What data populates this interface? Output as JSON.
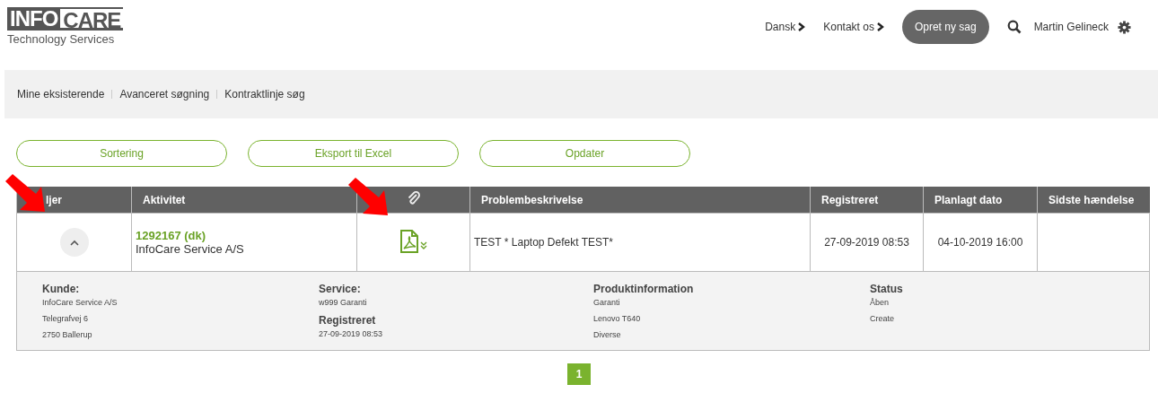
{
  "header": {
    "logo": {
      "left": "INFO",
      "right": "CARE",
      "tagline": "Technology Services"
    },
    "links": [
      {
        "label": "Dansk"
      },
      {
        "label": "Kontakt os"
      }
    ],
    "create_button": "Opret ny sag",
    "user_name": "Martin Gelineck"
  },
  "subnav": [
    "Mine eksisterende",
    "Avanceret søgning",
    "Kontraktlinje søg"
  ],
  "actions": [
    "Sortering",
    "Eksport til Excel",
    "Opdater"
  ],
  "table": {
    "columns": [
      {
        "label": "ljer",
        "kind": "text"
      },
      {
        "label": "Aktivitet",
        "kind": "text"
      },
      {
        "kind": "attachment"
      },
      {
        "label": "Problembeskrivelse",
        "kind": "text"
      },
      {
        "label": "Registreret",
        "kind": "text"
      },
      {
        "label": "Planlagt dato",
        "kind": "text"
      },
      {
        "label": "Sidste hændelse",
        "kind": "text"
      }
    ],
    "rows": [
      {
        "expanded": true,
        "activity_id": "1292167 (dk)",
        "customer": "InfoCare Service A/S",
        "problem": "TEST * Laptop Defekt TEST*",
        "registered": "27-09-2019 08:53",
        "planned": "04-10-2019 16:00",
        "details": [
          {
            "sections": [
              {
                "title": "Kunde:",
                "lines": [
                  "InfoCare Service A/S",
                  "Telegrafvej 6",
                  "2750 Ballerup"
                ]
              }
            ]
          },
          {
            "sections": [
              {
                "title": "Service:",
                "lines": [
                  "w999 Garanti"
                ]
              },
              {
                "title": "Registreret",
                "lines": [
                  "27-09-2019 08:53"
                ]
              }
            ]
          },
          {
            "sections": [
              {
                "title": "Produktinformation",
                "lines": [
                  "Garanti",
                  "Lenovo T640",
                  "Diverse"
                ]
              }
            ]
          },
          {
            "sections": [
              {
                "title": "Status",
                "lines": [
                  "Åben",
                  "Create"
                ]
              }
            ]
          }
        ]
      }
    ]
  },
  "pagination": [
    {
      "label": "1",
      "selected": true
    }
  ]
}
